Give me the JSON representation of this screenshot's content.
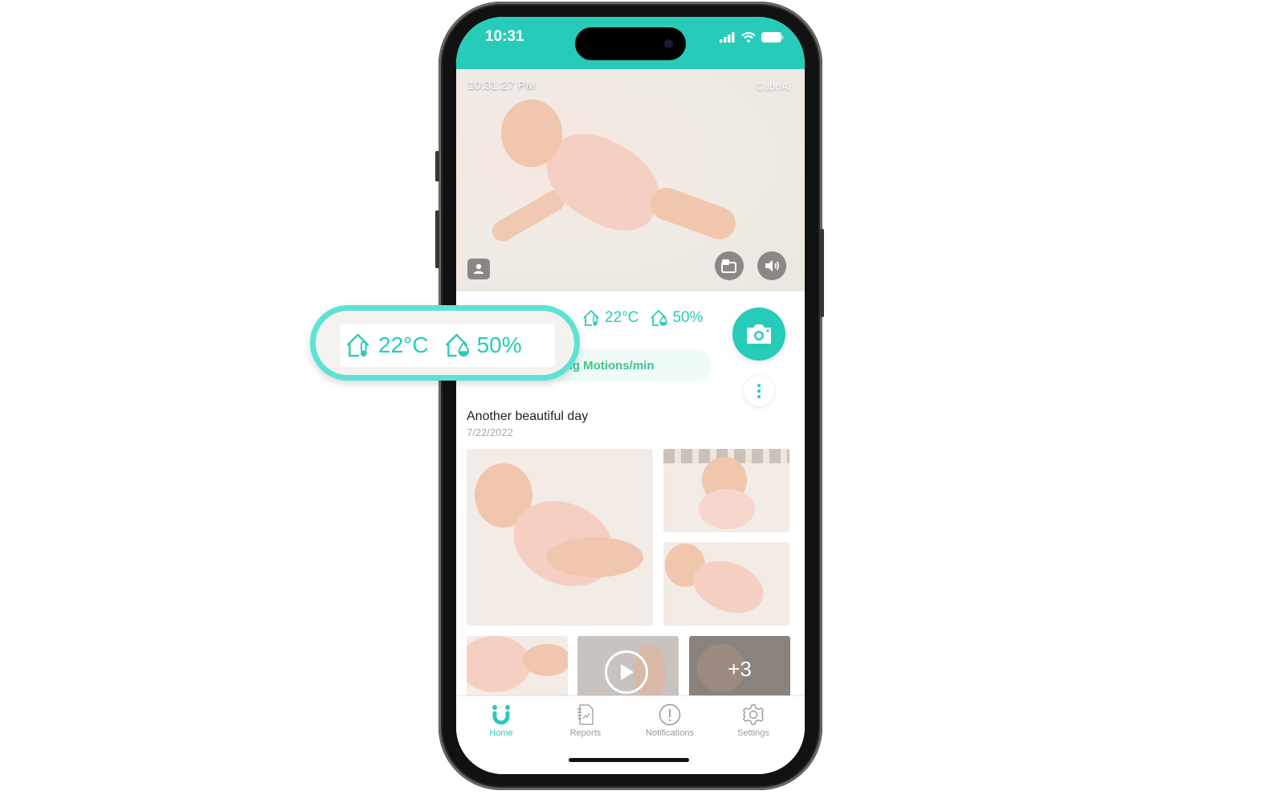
{
  "status_bar": {
    "time": "10:31"
  },
  "live_view": {
    "timestamp": "10:31:27 PM",
    "brand": "CuboAi"
  },
  "environment": {
    "temperature": "22°C",
    "humidity": "50%"
  },
  "motion": {
    "label": "Breathing Motions/min",
    "visible_label": "ing Motions/min"
  },
  "album": {
    "title": "Another beautiful day",
    "date": "7/22/2022",
    "more_count": "+3"
  },
  "callout": {
    "temperature": "22°C",
    "humidity": "50%"
  },
  "tabs": [
    {
      "label": "Home",
      "icon": "cubo-home-icon",
      "active": true
    },
    {
      "label": "Reports",
      "icon": "report-icon",
      "active": false
    },
    {
      "label": "Notifications",
      "icon": "alert-icon",
      "active": false
    },
    {
      "label": "Settings",
      "icon": "gear-icon",
      "active": false
    }
  ],
  "colors": {
    "accent": "#27ccb9",
    "callout_border": "#5de3d4",
    "motion_text": "#3cc58a"
  }
}
